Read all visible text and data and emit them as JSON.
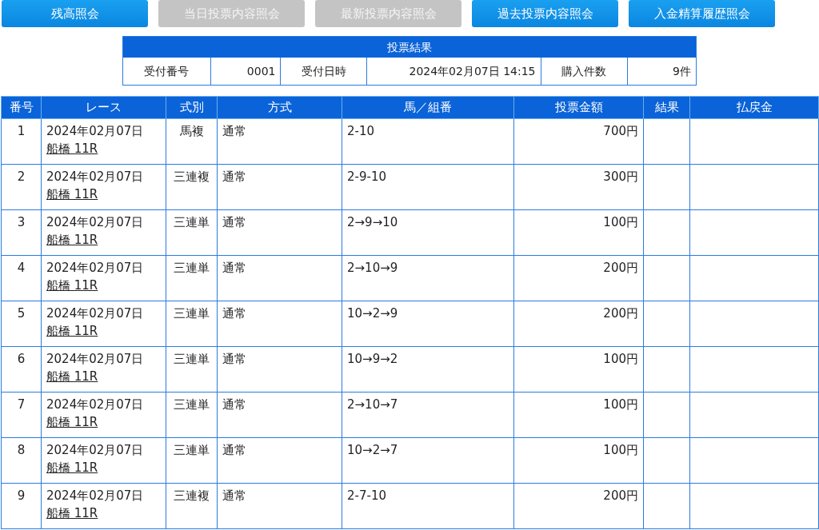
{
  "buttons": [
    {
      "label": "残高照会",
      "disabled": false
    },
    {
      "label": "当日投票内容照会",
      "disabled": true
    },
    {
      "label": "最新投票内容照会",
      "disabled": true
    },
    {
      "label": "過去投票内容照会",
      "disabled": false
    },
    {
      "label": "入金精算履歴照会",
      "disabled": false
    }
  ],
  "summary": {
    "title": "投票結果",
    "cells": [
      {
        "text": "受付番号",
        "kind": "label"
      },
      {
        "text": "0001",
        "kind": "value"
      },
      {
        "text": "受付日時",
        "kind": "label"
      },
      {
        "text": "2024年02月07日 14:15",
        "kind": "value"
      },
      {
        "text": "購入件数",
        "kind": "label"
      },
      {
        "text": "9件",
        "kind": "value"
      }
    ]
  },
  "table": {
    "columns": [
      "番号",
      "レース",
      "式別",
      "方式",
      "馬／組番",
      "投票金額",
      "結果",
      "払戻金"
    ],
    "rows": [
      {
        "no": "1",
        "date": "2024年02月07日",
        "race": "船橋 11R",
        "type": "馬複",
        "method": "通常",
        "combo": "2-10",
        "amount": "700円"
      },
      {
        "no": "2",
        "date": "2024年02月07日",
        "race": "船橋 11R",
        "type": "三連複",
        "method": "通常",
        "combo": "2-9-10",
        "amount": "300円"
      },
      {
        "no": "3",
        "date": "2024年02月07日",
        "race": "船橋 11R",
        "type": "三連単",
        "method": "通常",
        "combo": "2→9→10",
        "amount": "100円"
      },
      {
        "no": "4",
        "date": "2024年02月07日",
        "race": "船橋 11R",
        "type": "三連単",
        "method": "通常",
        "combo": "2→10→9",
        "amount": "200円"
      },
      {
        "no": "5",
        "date": "2024年02月07日",
        "race": "船橋 11R",
        "type": "三連単",
        "method": "通常",
        "combo": "10→2→9",
        "amount": "200円"
      },
      {
        "no": "6",
        "date": "2024年02月07日",
        "race": "船橋 11R",
        "type": "三連単",
        "method": "通常",
        "combo": "10→9→2",
        "amount": "100円"
      },
      {
        "no": "7",
        "date": "2024年02月07日",
        "race": "船橋 11R",
        "type": "三連単",
        "method": "通常",
        "combo": "2→10→7",
        "amount": "100円"
      },
      {
        "no": "8",
        "date": "2024年02月07日",
        "race": "船橋 11R",
        "type": "三連単",
        "method": "通常",
        "combo": "10→2→7",
        "amount": "100円"
      },
      {
        "no": "9",
        "date": "2024年02月07日",
        "race": "船橋 11R",
        "type": "三連複",
        "method": "通常",
        "combo": "2-7-10",
        "amount": "200円"
      }
    ]
  }
}
